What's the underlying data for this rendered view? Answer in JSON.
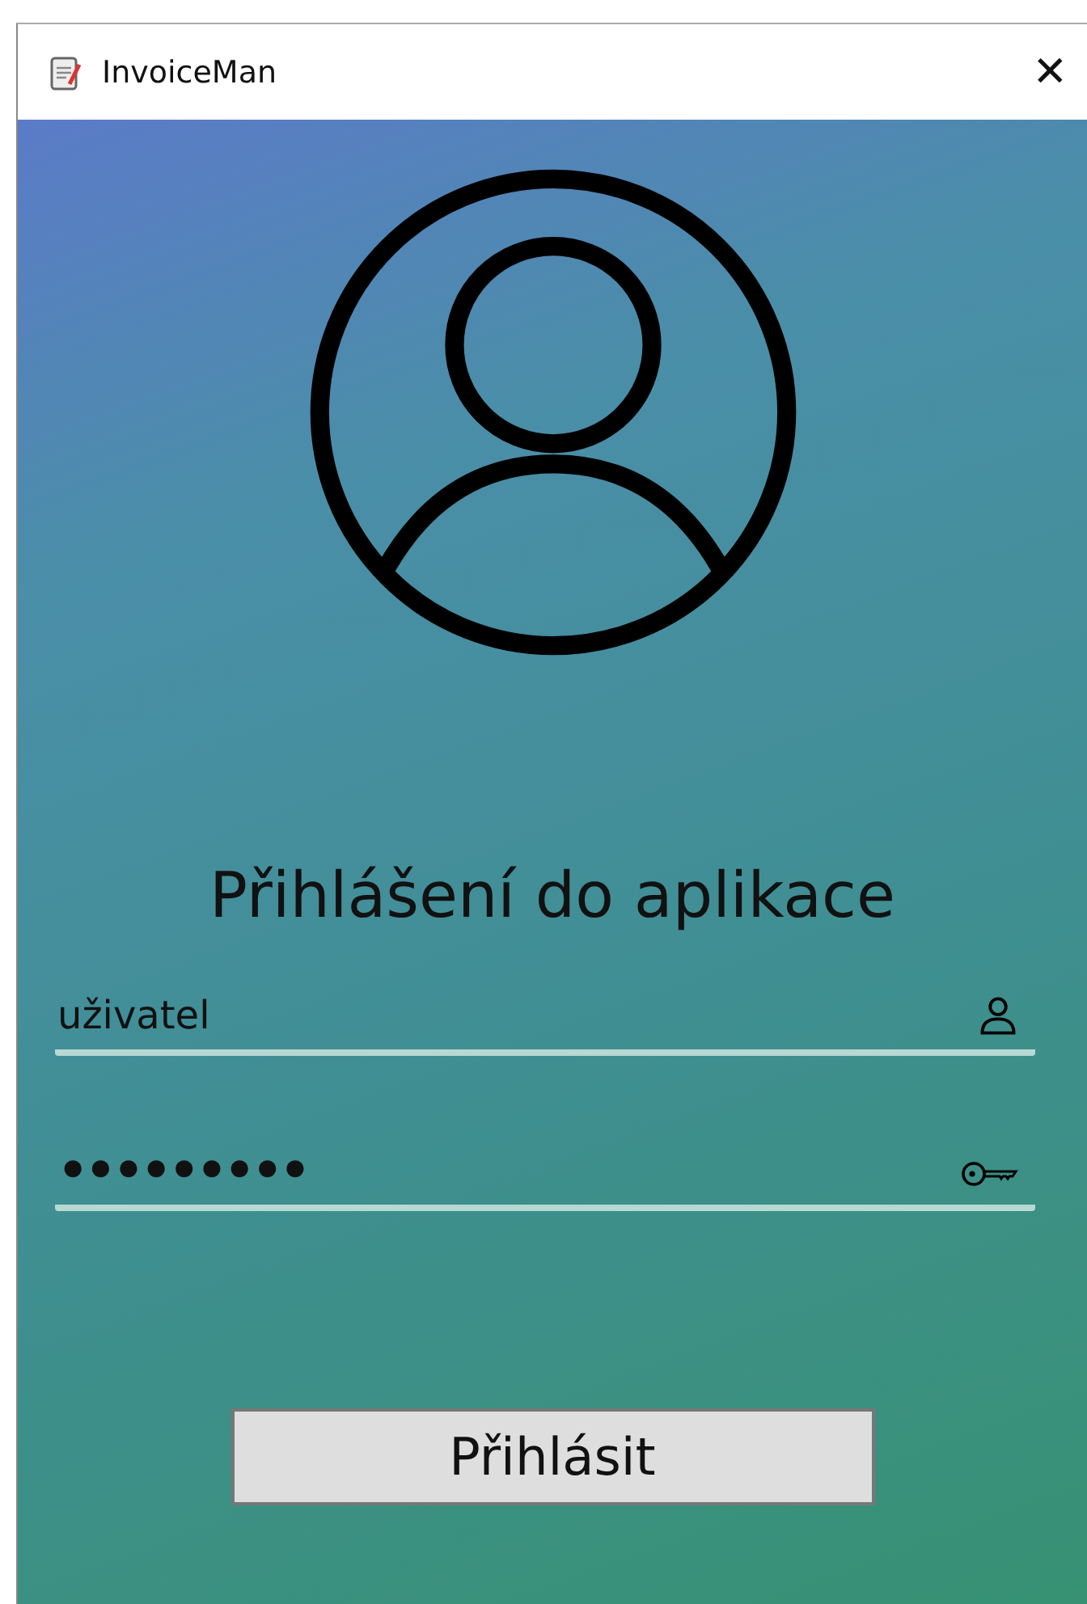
{
  "window": {
    "title": "InvoiceMan",
    "close": "✕"
  },
  "heading": "Přihlášení do aplikace",
  "username": {
    "value": "uživatel"
  },
  "password": {
    "value": "•••••••••"
  },
  "login_button": "Přihlásit"
}
